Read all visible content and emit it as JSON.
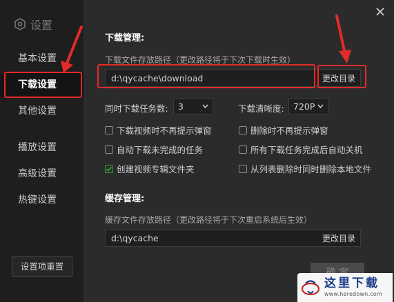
{
  "sidebar": {
    "title": "设置",
    "items": [
      {
        "label": "基本设置",
        "active": false
      },
      {
        "label": "下载设置",
        "active": true
      },
      {
        "label": "其他设置",
        "active": false
      },
      {
        "label": "播放设置",
        "active": false
      },
      {
        "label": "高级设置",
        "active": false
      },
      {
        "label": "热键设置",
        "active": false
      }
    ],
    "reset_label": "设置项重置"
  },
  "download": {
    "title": "下载管理:",
    "path_label": "下载文件存放路径（更改路径将于下次下载时生效）",
    "path_value": "d:\\qycache\\download",
    "change_label": "更改目录",
    "concurrent_label": "同时下载任务数:",
    "concurrent_value": "3",
    "quality_label": "下载清晰度:",
    "quality_value": "720P",
    "options": [
      {
        "label": "下载视频时不再提示弹窗",
        "checked": false
      },
      {
        "label": "删除时不再提示弹窗",
        "checked": false
      },
      {
        "label": "自动下载未完成的任务",
        "checked": false
      },
      {
        "label": "所有下载任务完成后自动关机",
        "checked": false
      },
      {
        "label": "创建视频专辑文件夹",
        "checked": true
      },
      {
        "label": "从列表删除时同时删除本地文件",
        "checked": false
      }
    ]
  },
  "cache": {
    "title": "缓存管理:",
    "path_label": "缓存文件存放路径（更改路径将于下次重启系统后生效）",
    "path_value": "d:\\qycache",
    "change_label": "更改目录"
  },
  "confirm_label": "确 定",
  "watermark": {
    "brand": "这里下载",
    "url": "www.heredown.com"
  },
  "colors": {
    "annotation": "#e32a2a",
    "checked": "#2fa33a",
    "background": "#2b2b2b",
    "sidebar": "#1e1e1e"
  }
}
